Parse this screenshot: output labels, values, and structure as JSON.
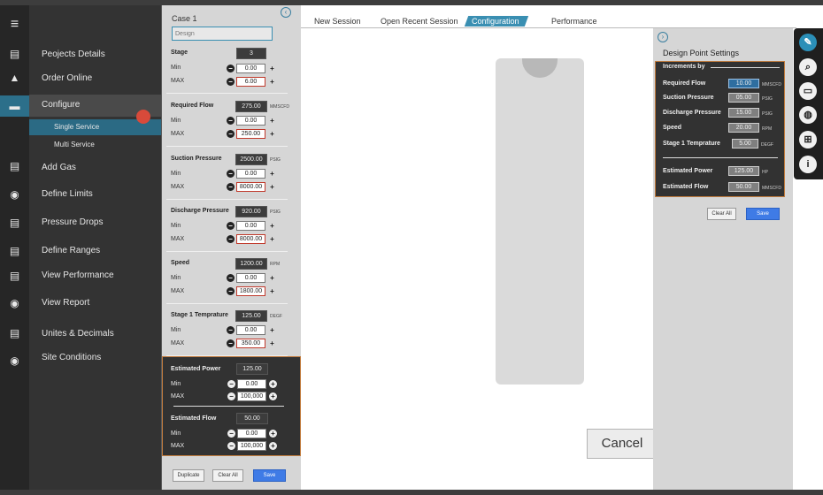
{
  "nav": {
    "items": [
      {
        "label": "Peojects Details"
      },
      {
        "label": "Order Online"
      },
      {
        "label": "Configure"
      },
      {
        "label": "Single Service"
      },
      {
        "label": "Multi Service"
      },
      {
        "label": "Add Gas"
      },
      {
        "label": "Define Limits"
      },
      {
        "label": "Pressure Drops"
      },
      {
        "label": "Define Ranges"
      },
      {
        "label": "View Performance"
      },
      {
        "label": "View Report"
      },
      {
        "label": "Unites & Decimals"
      },
      {
        "label": "Site Conditions"
      }
    ]
  },
  "case": {
    "title": "Case 1",
    "name_placeholder": "Design",
    "stage": {
      "label": "Stage",
      "value": "3",
      "min_label": "Min",
      "min": "0.00",
      "max_label": "MAX",
      "max": "6.00"
    },
    "params": [
      {
        "label": "Required Flow",
        "value": "275.00",
        "unit": "MMSCFD",
        "min_label": "Min",
        "min": "0.00",
        "max_label": "MAX",
        "max": "250.00"
      },
      {
        "label": "Suction Pressure",
        "value": "2500.00",
        "unit": "PSIG",
        "min_label": "Min",
        "min": "0.00",
        "max_label": "MAX",
        "max": "8000.00"
      },
      {
        "label": "Discharge Pressure",
        "value": "920.00",
        "unit": "PSIG",
        "min_label": "Min",
        "min": "0.00",
        "max_label": "MAX",
        "max": "8000.00"
      },
      {
        "label": "Speed",
        "value": "1200.00",
        "unit": "RPM",
        "min_label": "Min",
        "min": "0.00",
        "max_label": "MAX",
        "max": "1800.00"
      },
      {
        "label": "Stage 1 Temprature",
        "value": "125.00",
        "unit": "DEGF",
        "min_label": "Min",
        "min": "0.00",
        "max_label": "MAX",
        "max": "350.00"
      }
    ],
    "estimated": [
      {
        "label": "Estimated Power",
        "value": "125.00",
        "min_label": "Min",
        "min": "0.00",
        "max_label": "MAX",
        "max": "100,000"
      },
      {
        "label": "Estimated Flow",
        "value": "50.00",
        "min_label": "Min",
        "min": "0.00",
        "max_label": "MAX",
        "max": "100,000"
      }
    ],
    "buttons": {
      "duplicate": "Duplicate",
      "clear": "Clear All",
      "save": "Save"
    }
  },
  "tabs": [
    {
      "label": "New Session"
    },
    {
      "label": "Open Recent Session"
    },
    {
      "label": "Configuration"
    },
    {
      "label": "Performance"
    }
  ],
  "active_tab": "Configuration",
  "main": {
    "cancel_label": "Cancel"
  },
  "design": {
    "title": "Design Point Settings",
    "increments_label": "Increments by",
    "rows": [
      {
        "label": "Required Flow",
        "value": "10.00",
        "unit": "MMSCFD"
      },
      {
        "label": "Suction Pressure",
        "value": "05.00",
        "unit": "PSIG"
      },
      {
        "label": "Discharge Pressure",
        "value": "15.00",
        "unit": "PSIG"
      },
      {
        "label": "Speed",
        "value": "20.00",
        "unit": "RPM"
      },
      {
        "label": "Stage 1 Temprature",
        "value": "5.00",
        "unit": "DEGF"
      }
    ],
    "est_rows": [
      {
        "label": "Estimated Power",
        "value": "125.00",
        "unit": "HP"
      },
      {
        "label": "Estimated Flow",
        "value": "50.00",
        "unit": "MMSCFD"
      }
    ],
    "buttons": {
      "clear": "Clear All",
      "save": "Save"
    }
  },
  "colors": {
    "accent": "#2b6a84",
    "save": "#3f7be6",
    "highlight_border": "#c07a3c"
  },
  "icons": {
    "toolbar": [
      "wrench-icon",
      "search-icon",
      "print-icon",
      "globe-icon",
      "cart-icon",
      "info-icon"
    ]
  }
}
